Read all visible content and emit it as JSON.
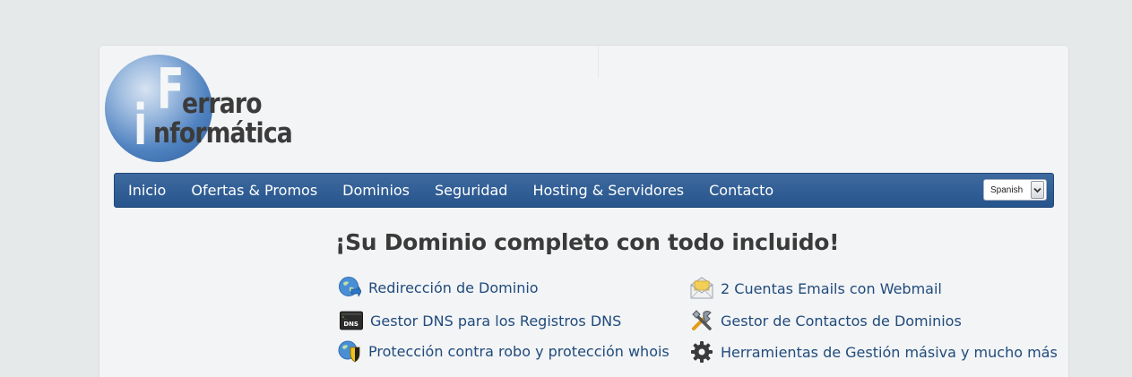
{
  "logo": {
    "letter_top": "F",
    "letter_bottom": "i",
    "line1": "erraro",
    "line2": "nformática",
    "colors": {
      "circle": "#4f82c0",
      "text": "#3b3b3b"
    }
  },
  "nav": {
    "items": [
      "Inicio",
      "Ofertas & Promos",
      "Dominios",
      "Seguridad",
      "Hosting & Servidores",
      "Contacto"
    ],
    "language": {
      "selected": "Spanish"
    },
    "colors": {
      "bar": "#2f5d94",
      "text": "#ffffff"
    }
  },
  "main": {
    "headline": "¡Su Dominio completo con todo incluido!",
    "features_left": [
      {
        "icon": "globe-redirect-icon",
        "label": "Redirección de Dominio"
      },
      {
        "icon": "dns-terminal-icon",
        "label": "Gestor DNS para los Registros DNS"
      },
      {
        "icon": "globe-shield-icon",
        "label": "Protección contra robo y protección whois"
      }
    ],
    "features_right": [
      {
        "icon": "envelope-icon",
        "label": "2 Cuentas Emails con Webmail"
      },
      {
        "icon": "tools-icon",
        "label": "Gestor de Contactos de Dominios"
      },
      {
        "icon": "gear-icon",
        "label": "Herramientas de Gestión másiva y mucho más"
      }
    ],
    "colors": {
      "headline": "#3a3a3a",
      "link": "#204b7c"
    }
  }
}
